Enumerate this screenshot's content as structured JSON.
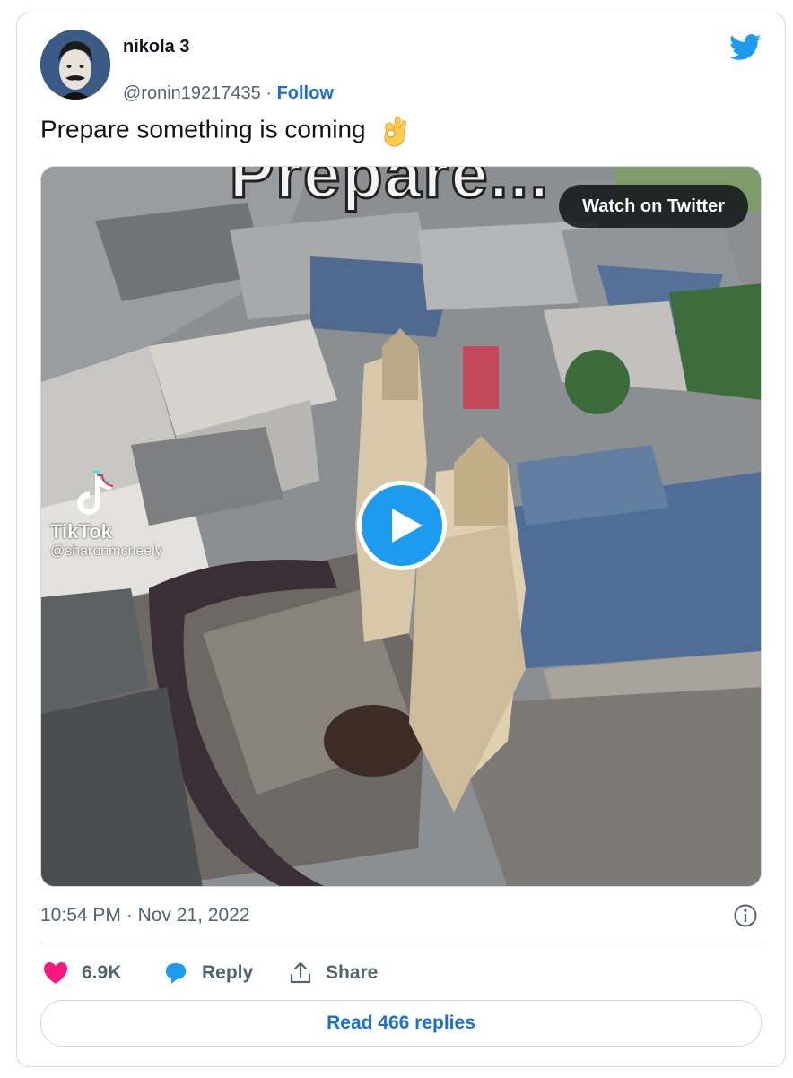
{
  "author": {
    "name": "nikola 3",
    "handle": "@ronin19217435",
    "separator": "·",
    "follow_label": "Follow"
  },
  "tweet": {
    "text": "Prepare something is coming",
    "emoji": "ok-hand-emoji"
  },
  "media": {
    "overlay_text": "Prepare...",
    "watch_label": "Watch on Twitter",
    "tiktok_brand": "TikTok",
    "tiktok_user": "@sharonmcneely"
  },
  "meta": {
    "time": "10:54 PM",
    "separator": "·",
    "date": "Nov 21, 2022"
  },
  "actions": {
    "like_count": "6.9K",
    "reply_label": "Reply",
    "share_label": "Share"
  },
  "footer": {
    "read_replies_label": "Read 466 replies"
  },
  "colors": {
    "accent": "#1d9bf0",
    "like": "#f91880",
    "link": "#1a6fd1",
    "muted": "#536471"
  }
}
